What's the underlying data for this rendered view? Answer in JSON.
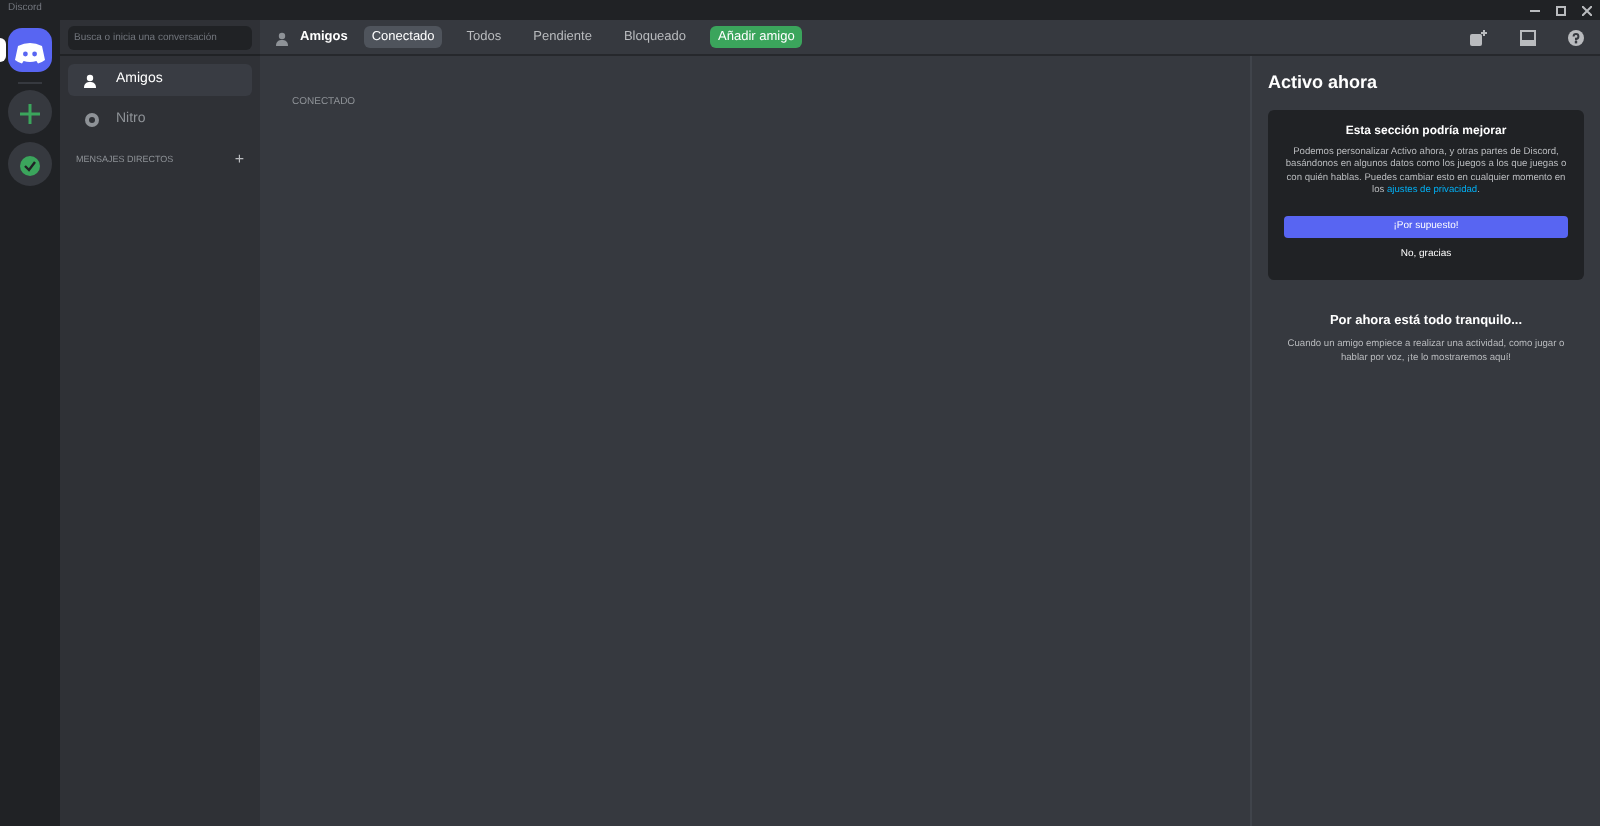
{
  "window": {
    "title": "Discord"
  },
  "server_rail": [
    {
      "kind": "home",
      "selected": true
    },
    {
      "kind": "add",
      "selected": false
    },
    {
      "kind": "explore",
      "selected": false
    }
  ],
  "sidebar": {
    "search": {
      "placeholder": "Busca o inicia una conversación"
    },
    "items": [
      {
        "kind": "friends",
        "label": "Amigos",
        "selected": true
      },
      {
        "kind": "nitro",
        "label": "Nitro",
        "selected": false
      }
    ],
    "section": {
      "label": "MENSAJES DIRECTOS",
      "add": "+"
    }
  },
  "header": {
    "title": "Amigos",
    "tabs": [
      {
        "kind": "tab",
        "label": "Conectado",
        "selected": true
      },
      {
        "kind": "tab",
        "label": "Todos",
        "selected": false
      },
      {
        "kind": "tab",
        "label": "Pendiente",
        "selected": false
      },
      {
        "kind": "tab",
        "label": "Bloqueado",
        "selected": false
      },
      {
        "kind": "add",
        "label": "Añadir amigo",
        "selected": false
      }
    ]
  },
  "main": {
    "section_label": "CONECTADO"
  },
  "active_now": {
    "title": "Activo ahora",
    "card": {
      "title": "Esta sección podría mejorar",
      "text": "Podemos personalizar Activo ahora, y otras partes de Discord, basándonos en algunos datos como los juegos a los que juegas o con quién hablas. Puedes cambiar esto en cualquier momento en los ",
      "link": "ajustes de privacidad",
      "text_end": ".",
      "primary_button": "¡Por supuesto!",
      "secondary_button": "No, gracias"
    },
    "empty": {
      "title": "Por ahora está todo tranquilo...",
      "text": "Cuando un amigo empiece a realizar una actividad, como jugar o hablar por voz, ¡te lo mostraremos aquí!"
    }
  }
}
